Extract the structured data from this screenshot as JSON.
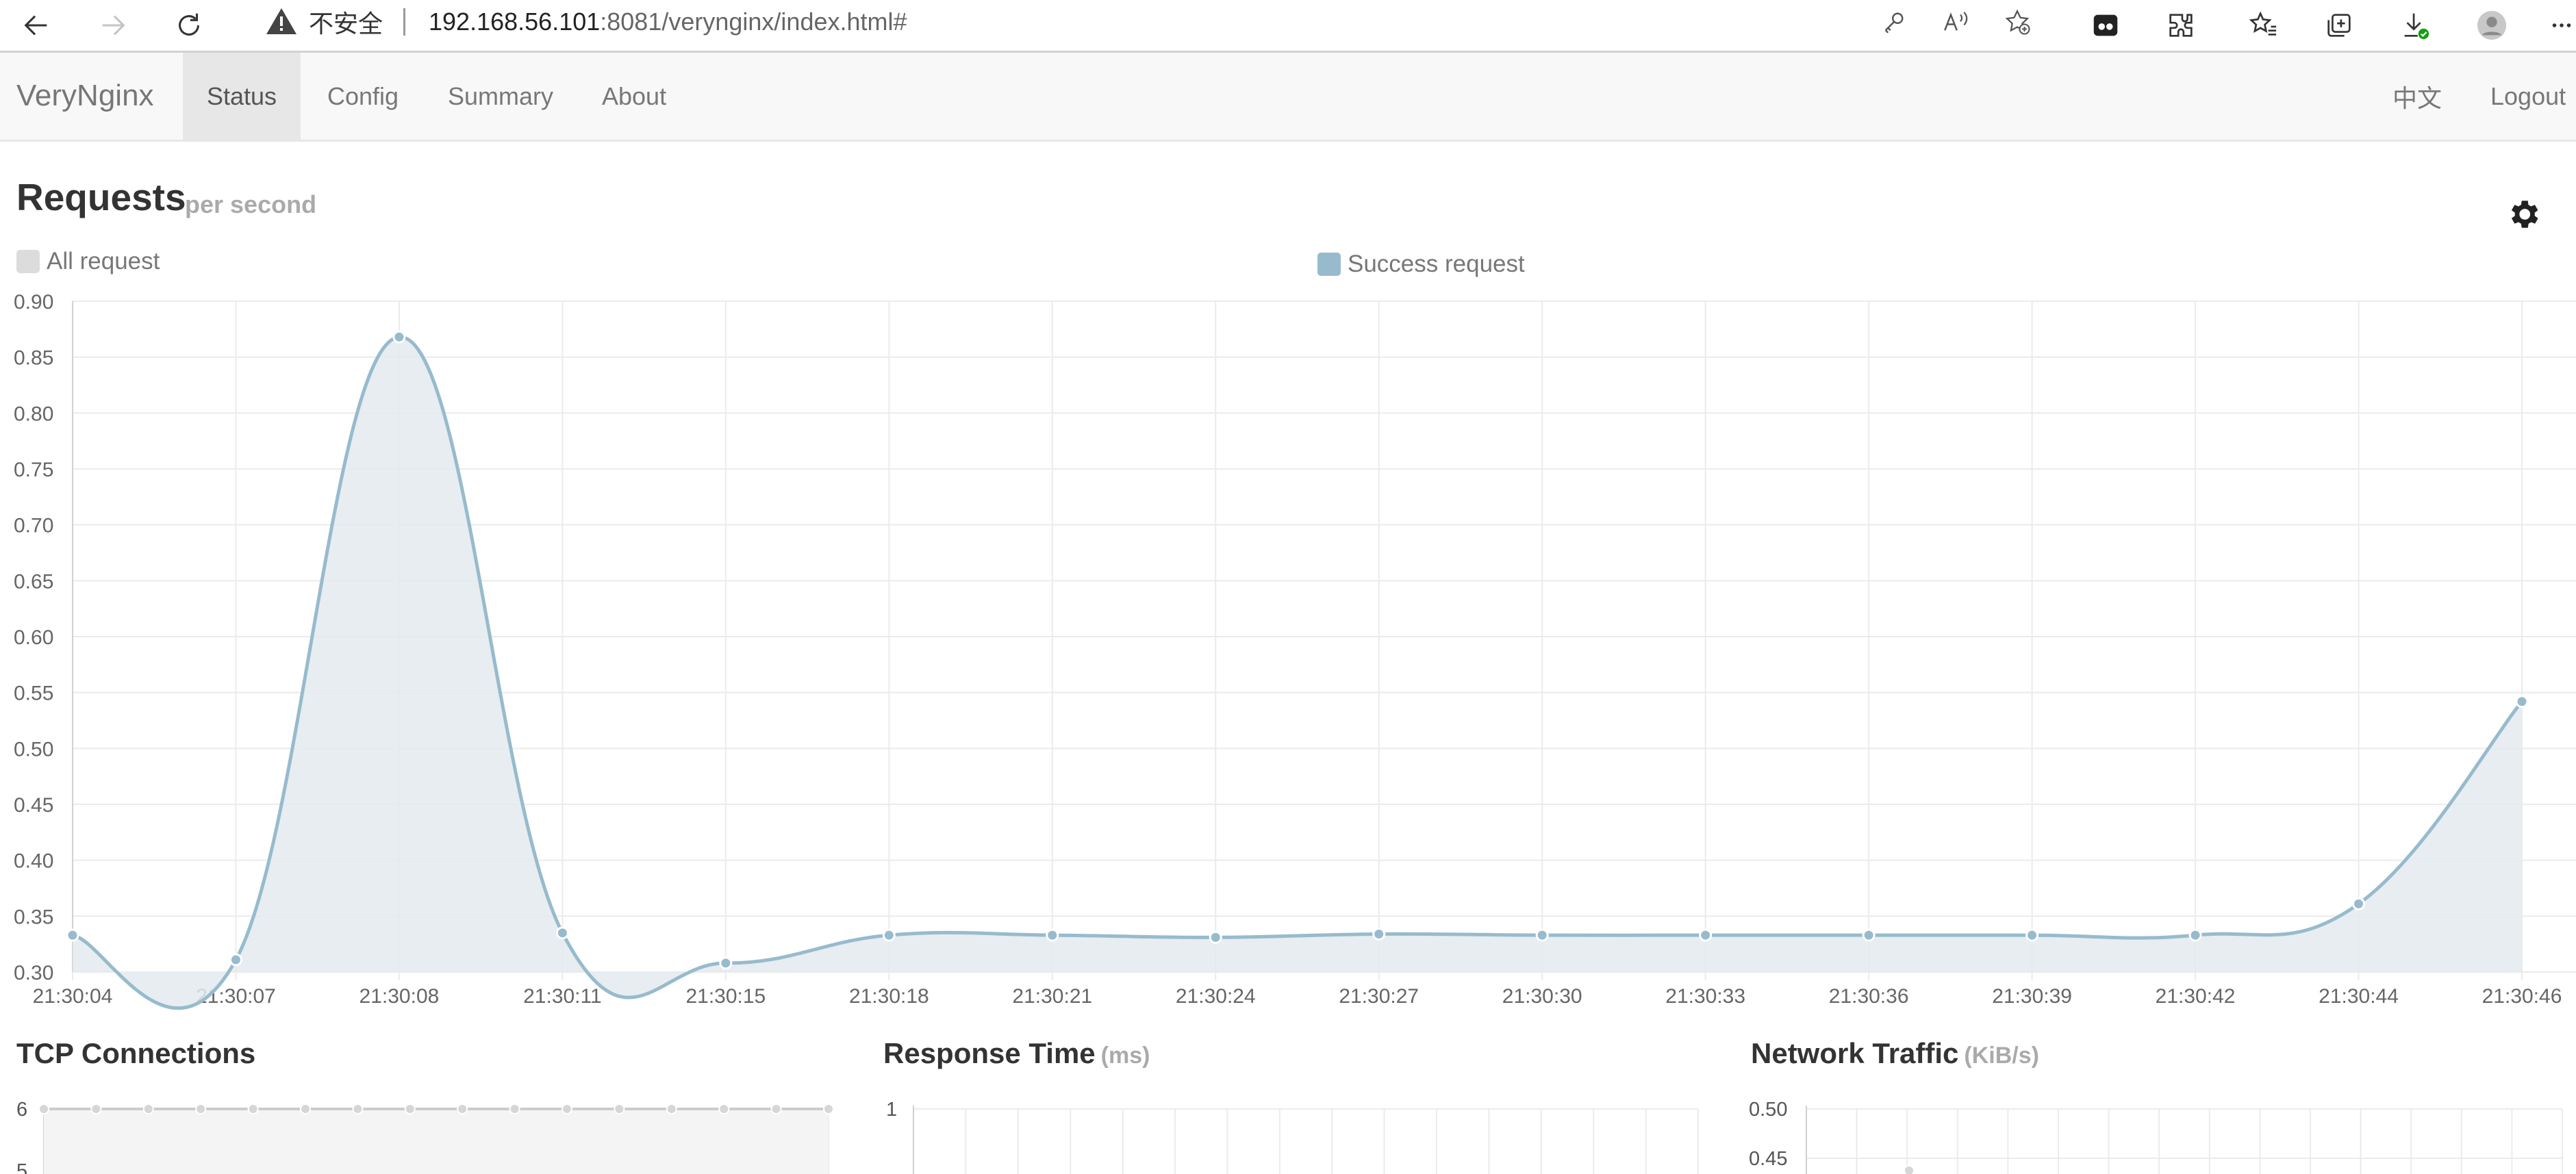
{
  "browser": {
    "security_label": "不安全",
    "url_host": "192.168.56.101",
    "url_rest": ":8081/verynginx/index.html#",
    "icons": [
      "back-icon",
      "forward-icon",
      "reload-icon",
      "warning-icon",
      "key-icon",
      "read-aloud-icon",
      "add-favorite-icon",
      "collections-icon",
      "extensions-icon",
      "favorites-icon",
      "tabs-icon",
      "downloads-icon",
      "profile-icon",
      "more-icon"
    ]
  },
  "navbar": {
    "brand": "VeryNginx",
    "items": [
      {
        "label": "Status",
        "active": true
      },
      {
        "label": "Config"
      },
      {
        "label": "Summary"
      },
      {
        "label": "About"
      }
    ],
    "right_items": [
      {
        "label": "中文"
      },
      {
        "label": "Logout"
      }
    ]
  },
  "requests": {
    "title": "Requests",
    "subtitle": "per second",
    "legend": [
      {
        "label": "All request",
        "color": "#dcdcdc"
      },
      {
        "label": "Success request",
        "color": "#97bbcd"
      }
    ]
  },
  "chart_data": [
    {
      "type": "area",
      "title": "Requests",
      "subtitle": "per second",
      "x": [
        "21:30:04",
        "21:30:07",
        "21:30:08",
        "21:30:11",
        "21:30:15",
        "21:30:18",
        "21:30:21",
        "21:30:24",
        "21:30:27",
        "21:30:30",
        "21:30:33",
        "21:30:36",
        "21:30:39",
        "21:30:42",
        "21:30:44",
        "21:30:46"
      ],
      "ylim": [
        0.3,
        0.9
      ],
      "yticks": [
        "0.90",
        "0.85",
        "0.80",
        "0.75",
        "0.70",
        "0.65",
        "0.60",
        "0.55",
        "0.50",
        "0.45",
        "0.40",
        "0.35",
        "0.30"
      ],
      "series": [
        {
          "name": "Success request",
          "color": "#97bbcd",
          "values": [
            0.333,
            0.311,
            0.868,
            0.335,
            0.308,
            0.333,
            0.333,
            0.331,
            0.334,
            0.333,
            0.333,
            0.333,
            0.333,
            0.333,
            0.361,
            0.542
          ]
        }
      ],
      "grid": true,
      "legend": "top"
    },
    {
      "type": "line",
      "title": "TCP Connections",
      "yticks": [
        "6",
        "5"
      ],
      "series": [
        {
          "values": [
            6,
            6,
            6,
            6,
            6,
            6,
            6,
            6,
            6,
            6,
            6,
            6,
            6,
            6,
            6,
            6
          ]
        }
      ],
      "grid": true
    },
    {
      "type": "line",
      "title": "Response Time",
      "unit": "(ms)",
      "yticks": [
        "1"
      ],
      "grid": true
    },
    {
      "type": "line",
      "title": "Network Traffic",
      "unit": "(KiB/s)",
      "yticks": [
        "0.50",
        "0.45"
      ],
      "grid": true
    }
  ],
  "panels": {
    "tcp": {
      "title": "TCP Connections"
    },
    "response": {
      "title": "Response Time",
      "unit": "(ms)"
    },
    "traffic": {
      "title": "Network Traffic",
      "unit": "(KiB/s)"
    }
  },
  "colors": {
    "accent_line": "#97bbcd",
    "fill": "#e3eaee",
    "grid": "#ebebeb",
    "navbar_bg": "#f8f8f8"
  }
}
